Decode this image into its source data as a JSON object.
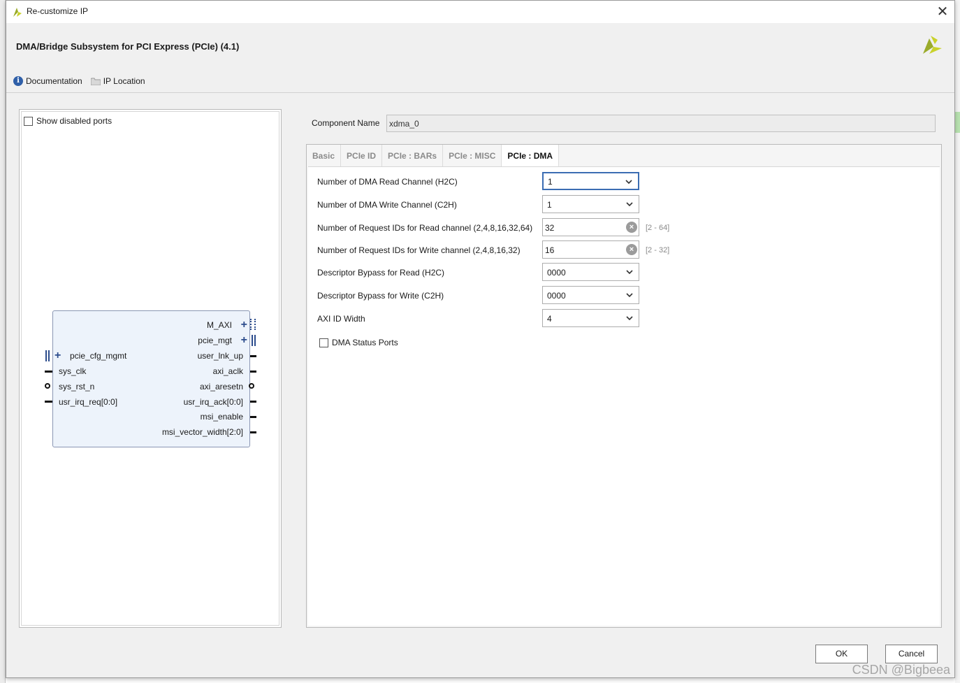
{
  "window": {
    "title": "Re-customize IP",
    "close_glyph": "✕",
    "app_icon": "vivado-logo-icon"
  },
  "header": {
    "ip_title": "DMA/Bridge Subsystem for PCI Express (PCIe) (4.1)",
    "links": [
      {
        "label": "Documentation",
        "icon": "info-icon"
      },
      {
        "label": "IP Location",
        "icon": "folder-icon"
      }
    ]
  },
  "left_panel": {
    "show_disabled_ports_label": "Show disabled ports",
    "show_disabled_ports_checked": false,
    "symbol": {
      "right_ports": [
        "M_AXI",
        "pcie_mgt",
        "user_lnk_up",
        "axi_aclk",
        "axi_aresetn",
        "usr_irq_ack[0:0]",
        "msi_enable",
        "msi_vector_width[2:0]"
      ],
      "left_ports": [
        "pcie_cfg_mgmt",
        "sys_clk",
        "sys_rst_n",
        "usr_irq_req[0:0]"
      ]
    }
  },
  "component": {
    "label": "Component Name",
    "value": "xdma_0"
  },
  "tabs": [
    "Basic",
    "PCIe ID",
    "PCIe : BARs",
    "PCIe : MISC",
    "PCIe : DMA"
  ],
  "active_tab": "PCIe : DMA",
  "dma": {
    "read_channel": {
      "label": "Number of DMA Read Channel (H2C)",
      "value": "1"
    },
    "write_channel": {
      "label": "Number of DMA Write Channel (C2H)",
      "value": "1"
    },
    "req_ids_read": {
      "label": "Number of Request IDs for Read channel (2,4,8,16,32,64)",
      "value": "32",
      "range": "[2 - 64]"
    },
    "req_ids_write": {
      "label": "Number of Request IDs for Write channel (2,4,8,16,32)",
      "value": "16",
      "range": "[2 - 32]"
    },
    "bypass_read": {
      "label": "Descriptor Bypass for Read (H2C)",
      "value": "0000"
    },
    "bypass_write": {
      "label": "Descriptor Bypass for Write (C2H)",
      "value": "0000"
    },
    "axi_id_width": {
      "label": "AXI ID Width",
      "value": "4"
    },
    "status_ports": {
      "label": "DMA Status Ports",
      "checked": false
    }
  },
  "buttons": {
    "ok": "OK",
    "cancel": "Cancel"
  },
  "watermark": "CSDN @Bigbeea",
  "colors": {
    "accent": "#3b6db3",
    "logo": "#9aab2a",
    "symbol_fill": "#edf3fb"
  }
}
